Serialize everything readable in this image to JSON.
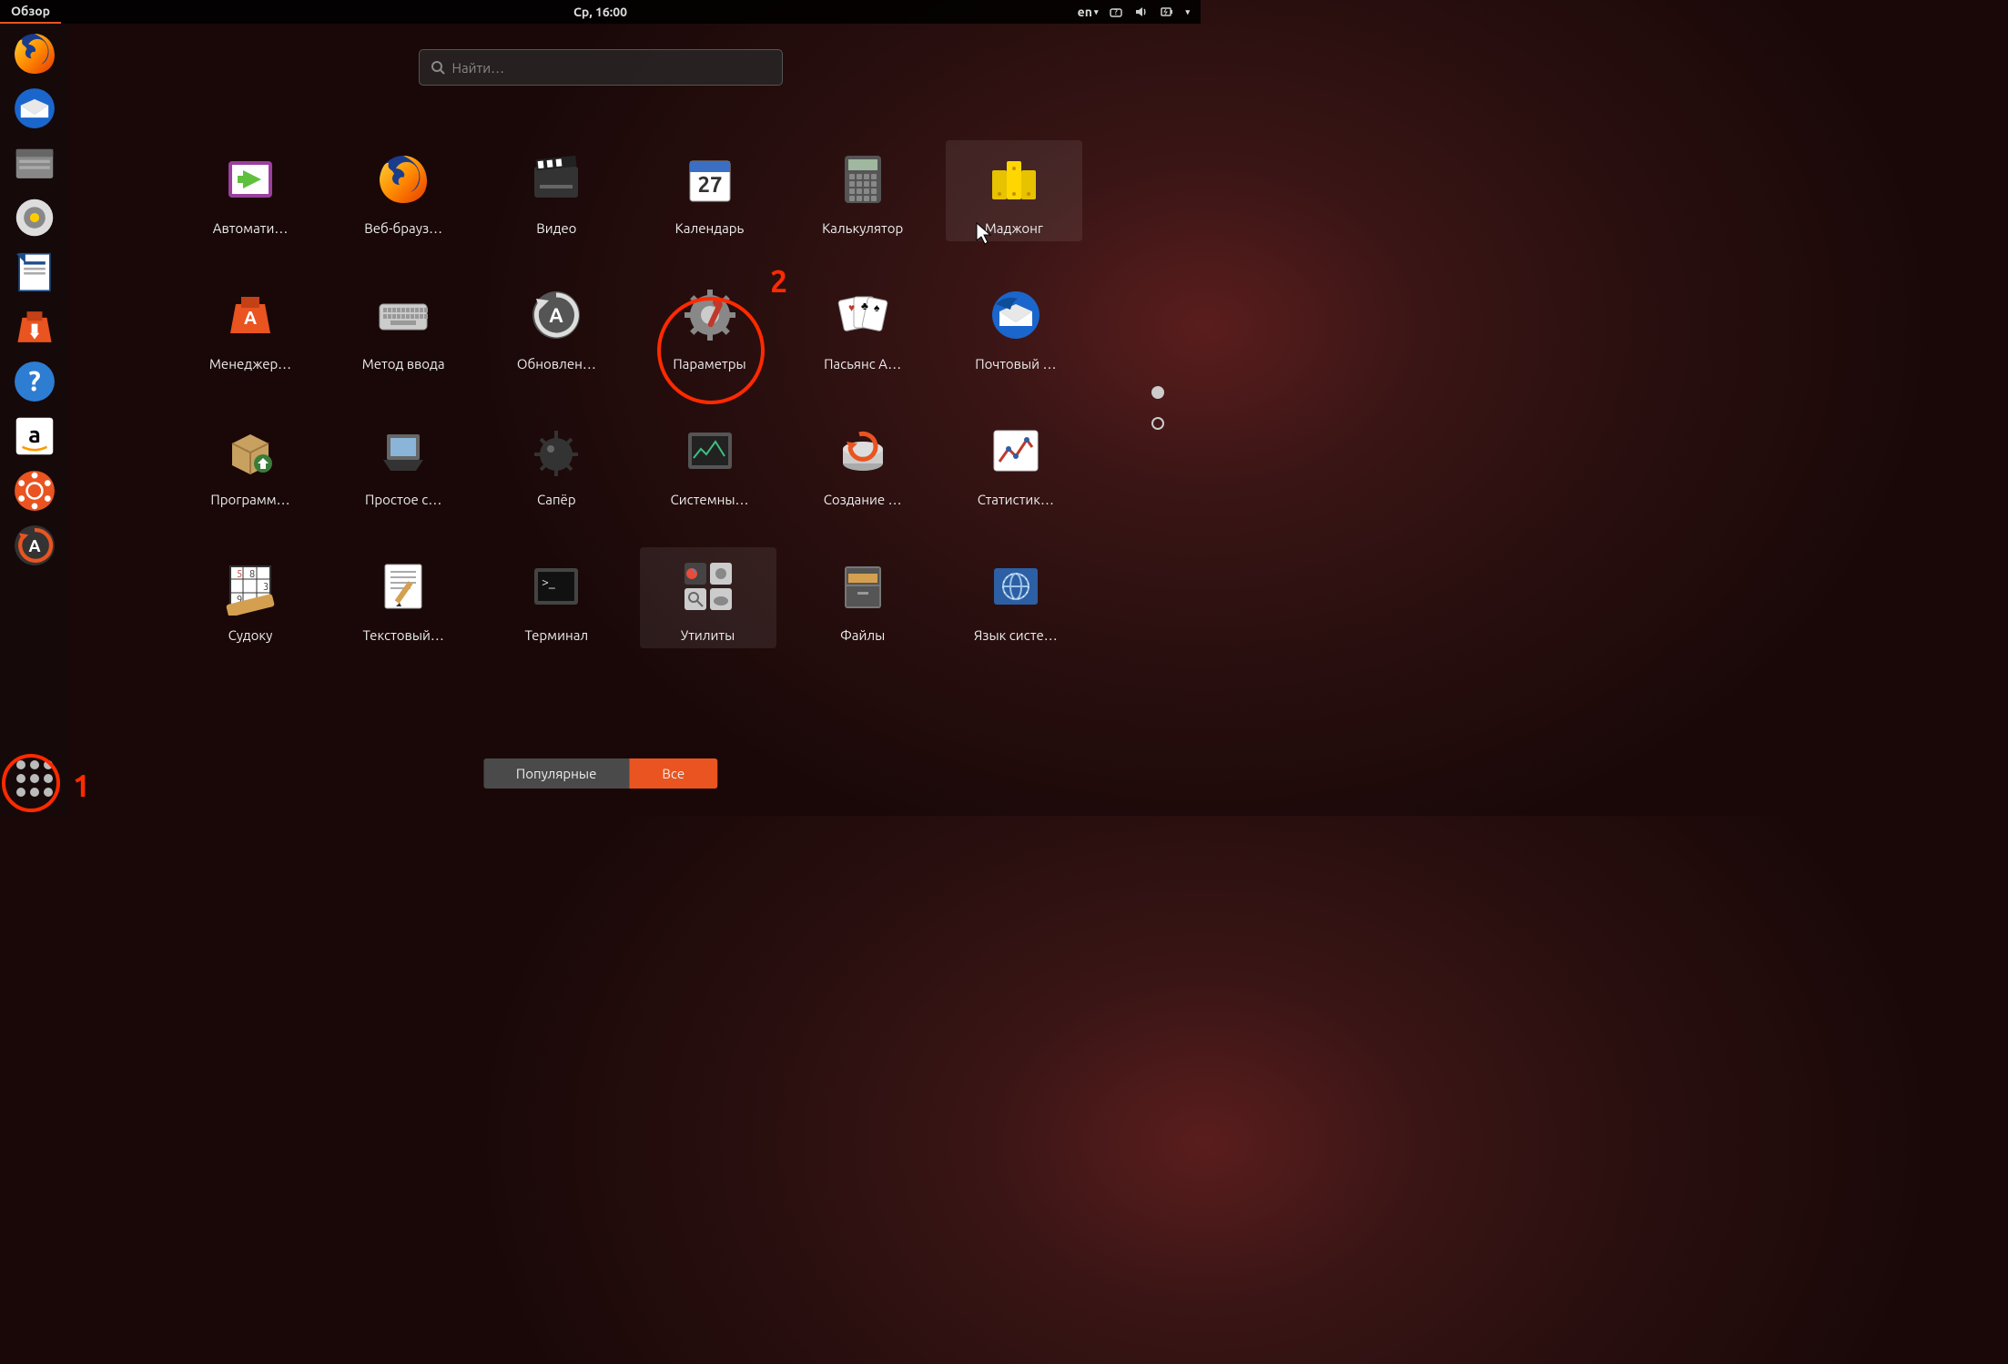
{
  "topbar": {
    "activities": "Обзор",
    "clock": "Ср, 16:00",
    "lang": "en"
  },
  "search": {
    "placeholder": "Найти…"
  },
  "dock": [
    {
      "name": "firefox"
    },
    {
      "name": "thunderbird"
    },
    {
      "name": "files"
    },
    {
      "name": "rhythmbox"
    },
    {
      "name": "writer"
    },
    {
      "name": "software"
    },
    {
      "name": "help"
    },
    {
      "name": "amazon"
    },
    {
      "name": "settings"
    },
    {
      "name": "updater"
    }
  ],
  "apps": [
    {
      "label": "Автомати…",
      "icon": "automation"
    },
    {
      "label": "Веб-брауз…",
      "icon": "firefox"
    },
    {
      "label": "Видео",
      "icon": "video"
    },
    {
      "label": "Календарь",
      "icon": "calendar",
      "day": "27"
    },
    {
      "label": "Калькулятор",
      "icon": "calculator"
    },
    {
      "label": "Маджонг",
      "icon": "mahjong",
      "hover": true
    },
    {
      "label": "Менеджер…",
      "icon": "software"
    },
    {
      "label": "Метод ввода",
      "icon": "keyboard"
    },
    {
      "label": "Обновлен…",
      "icon": "updater"
    },
    {
      "label": "Параметры",
      "icon": "settings"
    },
    {
      "label": "Пасьянс А…",
      "icon": "solitaire"
    },
    {
      "label": "Почтовый …",
      "icon": "thunderbird"
    },
    {
      "label": "Программ…",
      "icon": "package"
    },
    {
      "label": "Простое с…",
      "icon": "scanner"
    },
    {
      "label": "Сапёр",
      "icon": "mines"
    },
    {
      "label": "Системны…",
      "icon": "monitor"
    },
    {
      "label": "Создание …",
      "icon": "backup"
    },
    {
      "label": "Статистик…",
      "icon": "stats"
    },
    {
      "label": "Судоку",
      "icon": "sudoku"
    },
    {
      "label": "Текстовый…",
      "icon": "text"
    },
    {
      "label": "Терминал",
      "icon": "terminal"
    },
    {
      "label": "Утилиты",
      "icon": "utilities",
      "hover": true
    },
    {
      "label": "Файлы",
      "icon": "files-cabinet"
    },
    {
      "label": "Язык систе…",
      "icon": "language"
    }
  ],
  "tabs": {
    "frequent": "Популярные",
    "all": "Все"
  },
  "annotations": {
    "num1": "1",
    "num2": "2"
  }
}
